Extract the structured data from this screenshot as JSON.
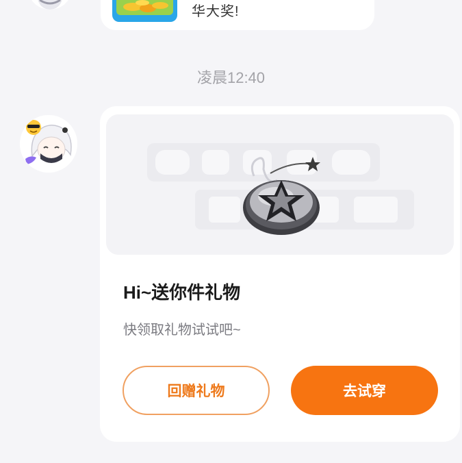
{
  "previous_message": {
    "text": "华大奖!"
  },
  "timestamp": "凌晨12:40",
  "gift_card": {
    "title": "Hi~送你件礼物",
    "subtitle": "快领取礼物试试吧~",
    "buttons": {
      "return_gift": "回赠礼物",
      "try_on": "去试穿"
    }
  },
  "colors": {
    "background": "#f5f5f8",
    "accent": "#f77411",
    "accent_outline": "#f0a060",
    "timestamp": "#a3a3a8"
  },
  "icons": {
    "sender_avatar": "anime-character-avatar",
    "gift_preview": "star-badge-item"
  }
}
